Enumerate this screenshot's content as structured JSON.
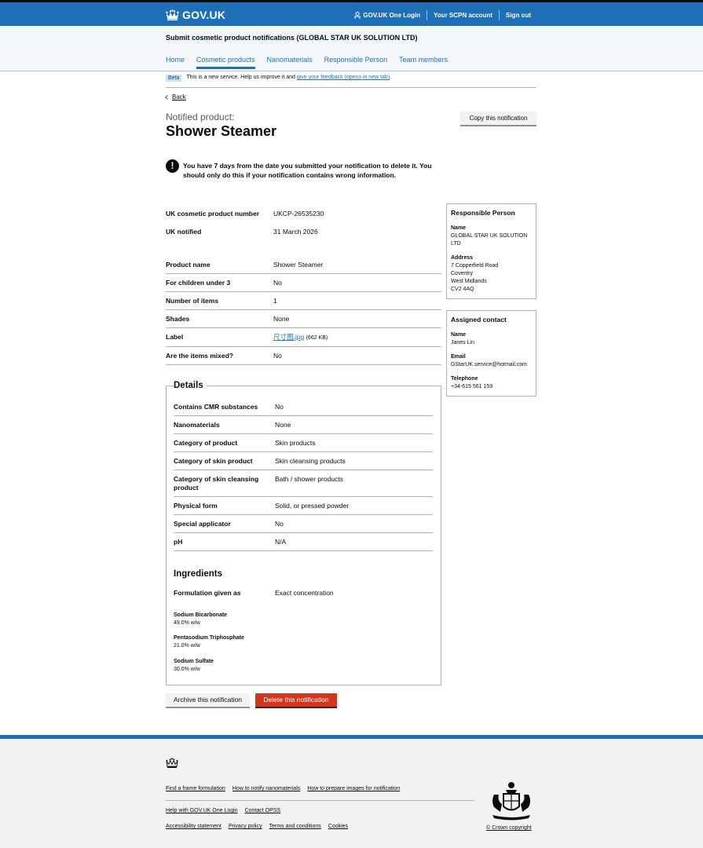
{
  "header": {
    "logo_text": "GOV.UK",
    "nav": [
      "GOV.UK One Login",
      "Your SCPN account",
      "Sign out"
    ]
  },
  "service": {
    "title": "Submit cosmetic product notifications (GLOBAL STAR UK SOLUTION LTD)",
    "nav": [
      "Home",
      "Cosmetic products",
      "Nanomaterials",
      "Responsible Person",
      "Team members"
    ],
    "active_index": 1
  },
  "phase": {
    "tag": "Beta",
    "text": "This is a new service. Help us improve it and",
    "link": "give your feedback (opens in new tab)",
    "end": "."
  },
  "back_label": "Back",
  "caption": "Notified product:",
  "title": "Shower Steamer",
  "copy_button": "Copy this notification",
  "warning": {
    "icon": "!",
    "text": "You have 7 days from the date you submitted your notification to delete it. You should only do this if your notification contains wrong information."
  },
  "notification_summary": [
    {
      "key": "UK cosmetic product number",
      "value": "UKCP-26535230"
    },
    {
      "key": "UK notified",
      "value": "31 March 2026"
    }
  ],
  "product_summary": [
    {
      "key": "Product name",
      "value": "Shower Steamer"
    },
    {
      "key": "For children under 3",
      "value": "No"
    },
    {
      "key": "Number of items",
      "value": "1"
    },
    {
      "key": "Shades",
      "value": "None"
    },
    {
      "key": "Label",
      "link": "尺寸图.jpg",
      "size": "(662 KB)"
    },
    {
      "key": "Are the items mixed?",
      "value": "No"
    }
  ],
  "details": {
    "legend": "Details",
    "rows": [
      {
        "key": "Contains CMR substances",
        "value": "No"
      },
      {
        "key": "Nanomaterials",
        "value": "None"
      },
      {
        "key": "Category of product",
        "value": "Skin products"
      },
      {
        "key": "Category of skin product",
        "value": "Skin cleansing products"
      },
      {
        "key": "Category of skin cleansing product",
        "value": "Bath / shower products"
      },
      {
        "key": "Physical form",
        "value": "Solid, or pressed powder"
      },
      {
        "key": "Special applicator",
        "value": "No"
      },
      {
        "key": "pH",
        "value": "N/A"
      }
    ]
  },
  "ingredients": {
    "title": "Ingredients",
    "formulation_key": "Formulation given as",
    "formulation_value": "Exact concentration",
    "items": [
      {
        "name": "Sodium Bicarbonate",
        "conc": "49.0% w/w"
      },
      {
        "name": "Pentasodium Triphosphate",
        "conc": "21.0% w/w"
      },
      {
        "name": "Sodium Sulfate",
        "conc": "30.0% w/w"
      }
    ]
  },
  "actions": {
    "archive": "Archive this notification",
    "delete": "Delete this notification"
  },
  "responsible_person": {
    "title": "Responsible Person",
    "name_label": "Name",
    "name": "GLOBAL STAR UK SOLUTION LTD",
    "address_label": "Address",
    "address": [
      "7 Copperfield Road",
      "Coventry",
      "West Midlands",
      "CV2 4AQ"
    ]
  },
  "assigned_contact": {
    "title": "Assigned contact",
    "name_label": "Name",
    "name": "Janes Lin",
    "email_label": "Email",
    "email": "GStarUK.service@hotmail.com",
    "phone_label": "Telephone",
    "phone": "+34-615 561 159"
  },
  "footer": {
    "links_row1": [
      "Find a frame formulation",
      "How to notify nanomaterials",
      "How to prepare images for notification"
    ],
    "links_row2": [
      "Help with GOV.UK One Login",
      "Contact OPSS"
    ],
    "links_row3": [
      "Accessibility statement",
      "Privacy policy",
      "Terms and conditions",
      "Cookies"
    ],
    "copyright": "© Crown copyright"
  }
}
